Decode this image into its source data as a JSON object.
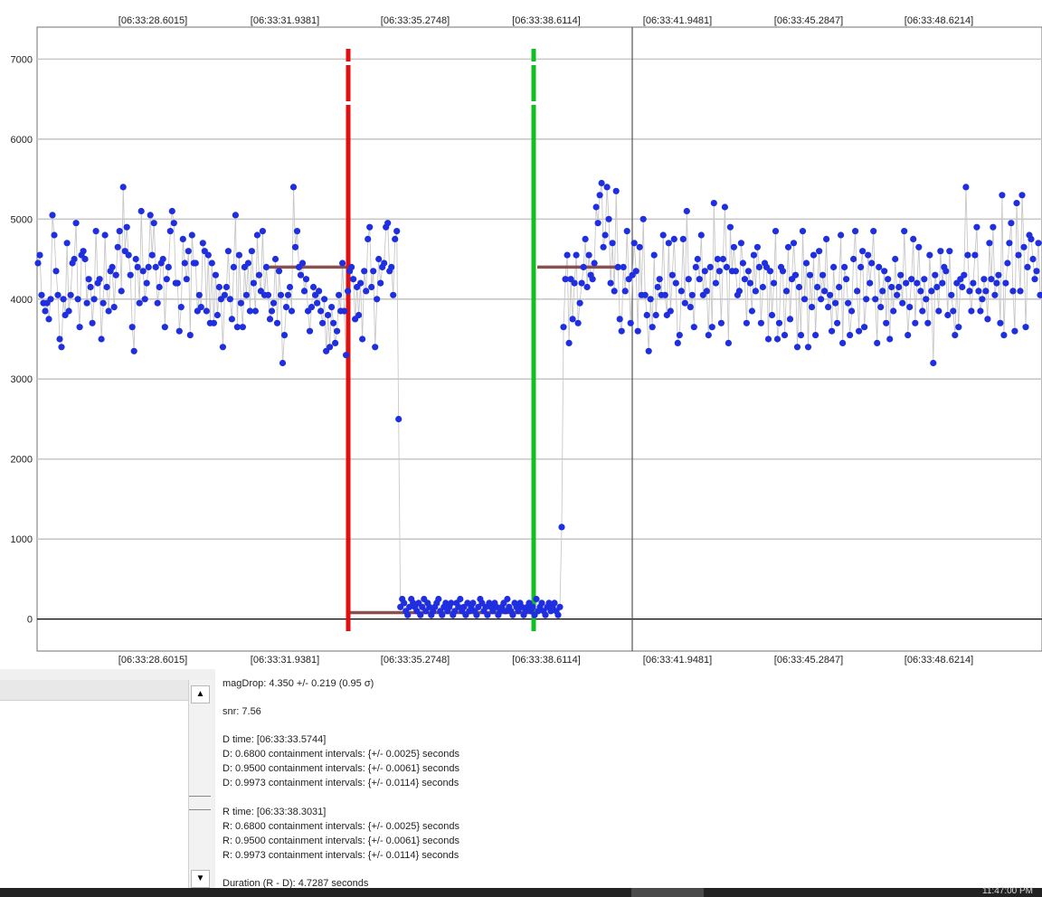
{
  "plot": {
    "time_labels": [
      "[06:33:28.6015]",
      "[06:33:31.9381]",
      "[06:33:35.2748]",
      "[06:33:38.6114]",
      "[06:33:41.9481]",
      "[06:33:45.2847]",
      "[06:33:48.6214]"
    ],
    "y_labels": [
      "7000",
      "6000",
      "5000",
      "4000",
      "3000",
      "2000",
      "1000",
      "0"
    ],
    "colors": {
      "points": "#1f2fe0",
      "connector": "#c8c8c8",
      "d_marker": "#e01010",
      "r_marker": "#10c020",
      "baseline": "#8a5050",
      "grid": "#c8c8c8",
      "zero_line": "#000000"
    }
  },
  "chart_data": {
    "type": "scatter",
    "ylim": [
      -400,
      7400
    ],
    "y_ticks": [
      0,
      1000,
      2000,
      3000,
      4000,
      5000,
      6000,
      7000
    ],
    "x_ticks": [
      "[06:33:28.6015]",
      "[06:33:31.9381]",
      "[06:33:35.2748]",
      "[06:33:38.6114]",
      "[06:33:41.9481]",
      "[06:33:45.2847]",
      "[06:33:48.6214]"
    ],
    "d_time": "[06:33:33.5744]",
    "r_time": "[06:33:38.3031]",
    "levels": {
      "pre_event": 4400,
      "in_event": 80,
      "post_event": 4400
    },
    "series": [
      {
        "values": [
          4450,
          4550,
          4050,
          3950,
          3850,
          3950,
          3750,
          4000,
          5050,
          4800,
          4350,
          4050,
          3500,
          3400,
          4000,
          3800,
          4700,
          3850,
          4050,
          4450,
          4500,
          4950,
          4000,
          3650,
          4550,
          4600,
          4500,
          3950,
          4250,
          4150,
          3700,
          4000,
          4850,
          4200,
          4250,
          3500,
          3950,
          4800,
          4150,
          3850,
          4350,
          4400,
          3900,
          4300,
          4650,
          4850,
          4100,
          5400,
          4600,
          4900,
          4550,
          4300,
          3650,
          3350,
          4500,
          4400,
          3950,
          5100,
          4350,
          4000,
          4200,
          4400,
          5050,
          4550,
          4950,
          4400,
          3950,
          4150,
          4450,
          4500,
          3650,
          4250,
          4400,
          4850,
          5100,
          4950,
          4200,
          4200,
          3600,
          3900,
          4750,
          4450,
          4250,
          4600,
          3550,
          4800,
          4450,
          4450,
          3850,
          4050,
          3900,
          4700,
          4600,
          3850,
          4550,
          3700,
          4450,
          3700,
          4300,
          3800,
          4150,
          4000,
          3400,
          4050,
          4150,
          4600,
          4000,
          3750,
          4400,
          5050,
          3650,
          4550,
          3950,
          3650,
          4400,
          4050,
          4450,
          3850,
          4600,
          4200,
          3850,
          4800,
          4300,
          4100,
          4850,
          4050,
          4400,
          4050,
          3750,
          3850,
          3950,
          4500,
          3700,
          4350,
          4050,
          3200,
          3550,
          3900,
          4050,
          4150,
          3850,
          5400,
          4650,
          4850,
          4400,
          4300,
          4450,
          4100,
          4250,
          3850,
          3600,
          3900,
          4150,
          4050,
          3950,
          4100,
          3850,
          3700,
          4000,
          3350,
          3800,
          3400,
          3900,
          3700,
          3450,
          3600,
          4050,
          3850,
          4450,
          3850,
          3300,
          4100,
          4350,
          4400,
          4250,
          3750,
          4150,
          3800,
          4200,
          3500,
          4350,
          4100,
          4750,
          4900,
          4150,
          4350,
          3400,
          4000,
          4500,
          4200,
          4400,
          4450,
          4900,
          4950,
          4350,
          4400,
          4050,
          4750,
          4850,
          2500,
          150,
          250,
          200,
          100,
          50,
          150,
          250,
          200,
          150,
          100,
          200,
          50,
          150,
          250,
          100,
          200,
          150,
          50,
          100,
          150,
          200,
          250,
          100,
          50,
          150,
          200,
          100,
          150,
          200,
          50,
          100,
          200,
          150,
          250,
          100,
          150,
          50,
          200,
          100,
          150,
          200,
          100,
          50,
          150,
          250,
          200,
          100,
          150,
          50,
          200,
          150,
          100,
          200,
          150,
          50,
          100,
          150,
          200,
          100,
          250,
          150,
          100,
          50,
          200,
          150,
          100,
          200,
          150,
          50,
          100,
          150,
          200,
          100,
          150,
          50,
          250,
          100,
          150,
          200,
          100,
          50,
          150,
          200,
          100,
          150,
          200,
          100,
          50,
          150,
          1150,
          3650,
          4250,
          4550,
          3450,
          4250,
          3750,
          4200,
          4550,
          3700,
          3950,
          4200,
          4400,
          4750,
          4150,
          4550,
          4300,
          4250,
          4450,
          5150,
          4950,
          5300,
          5450,
          4650,
          4800,
          5400,
          5000,
          4200,
          4700,
          4100,
          5350,
          4400,
          3750,
          3600,
          4400,
          4100,
          4850,
          4250,
          3700,
          4300,
          4700,
          4350,
          3600,
          4650,
          4050,
          5000,
          4050,
          3800,
          3350,
          4000,
          3650,
          4550,
          3800,
          4150,
          4250,
          4050,
          4800,
          4050,
          3800,
          4700,
          3850,
          4300,
          4750,
          4200,
          3450,
          3550,
          4100,
          4750,
          3950,
          5100,
          4250,
          3900,
          4050,
          3650,
          4400,
          4500,
          4250,
          4800,
          4050,
          4350,
          4100,
          3550,
          4400,
          3650,
          5200,
          4200,
          4500,
          4350,
          3700,
          4500,
          5150,
          4400,
          3450,
          4900,
          4350,
          4650,
          4350,
          4050,
          4100,
          4700,
          4450,
          4250,
          3700,
          4350,
          4200,
          3850,
          4550,
          4100,
          4650,
          4400,
          3700,
          4150,
          4450,
          4400,
          3500,
          4350,
          3800,
          4200,
          4850,
          3500,
          3700,
          4400,
          4350,
          3550,
          4100,
          4650,
          3750,
          4250,
          4700,
          4300,
          3400,
          4150,
          3550,
          4850,
          4000,
          4450,
          3400,
          4300,
          3900,
          4550,
          3550,
          4150,
          4600,
          4000,
          4300,
          4100,
          4750,
          3900,
          4050,
          3600,
          4400,
          3950,
          3700,
          4150,
          4800,
          3450,
          4400,
          4250,
          3950,
          3550,
          3850,
          4500,
          4850,
          4100,
          3600,
          4400,
          4600,
          3650,
          4000,
          4550,
          4200,
          4450,
          4850,
          4000,
          3450,
          4400,
          3900,
          4100,
          4350,
          3700,
          4250,
          3500,
          4150,
          3850,
          4500,
          4050,
          4150,
          4300,
          3950,
          4850,
          4200,
          3550,
          3900,
          4250,
          4750,
          3700,
          4200,
          4650,
          4100,
          3850,
          4250,
          4000,
          3700,
          4550,
          4100,
          3200,
          4300,
          4150,
          3850,
          4600,
          4200,
          4400,
          4350,
          3800,
          4600,
          4050,
          3850,
          3550,
          4200,
          3650,
          4250,
          4150,
          4300,
          5400,
          4550,
          4100,
          3850,
          4200,
          4550,
          4900,
          4100,
          3850,
          4000,
          4250,
          4100,
          3750,
          4700,
          4250,
          4900,
          4050,
          4200,
          4300,
          3700,
          5300,
          3550,
          4200,
          4450,
          4700,
          4950,
          4100,
          3600,
          5200,
          4550,
          4100,
          5300,
          4650,
          3650,
          4400,
          4800,
          4750,
          4500,
          4250,
          4350,
          4700,
          4050
        ]
      }
    ]
  },
  "left_list": {
    "scroll_up_glyph": "▲",
    "scroll_down_glyph": "▼"
  },
  "stats": {
    "lines": [
      "magDrop: 4.350 +/- 0.219 (0.95 σ)",
      "",
      "snr: 7.56",
      "",
      "D time: [06:33:33.5744]",
      "D: 0.6800 containment intervals: {+/- 0.0025} seconds",
      "D: 0.9500 containment intervals: {+/- 0.0061} seconds",
      "D: 0.9973 containment intervals: {+/- 0.0114} seconds",
      "",
      "R time: [06:33:38.3031]",
      "R: 0.6800 containment intervals: {+/- 0.0025} seconds",
      "R: 0.9500 containment intervals: {+/- 0.0061} seconds",
      "R: 0.9973 containment intervals: {+/- 0.0114} seconds",
      "",
      "Duration (R - D): 4.7287 seconds"
    ]
  },
  "taskbar": {
    "clock_text": "11:47:00 PM"
  }
}
